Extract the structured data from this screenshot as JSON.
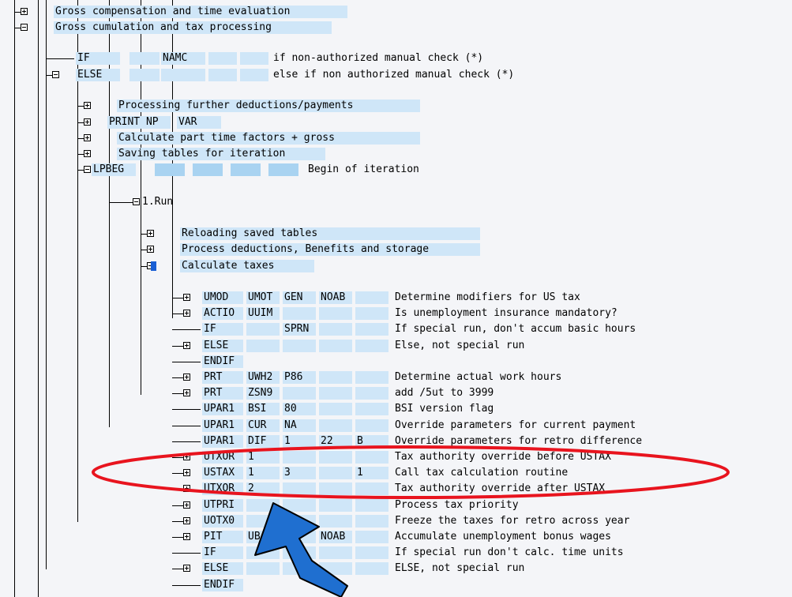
{
  "tree": {
    "nodes": [
      {
        "icon": "expand-plus-icon",
        "cols": [
          "Gross compensation and time evaluation"
        ]
      },
      {
        "icon": "collapse-minus-icon",
        "cols": [
          "Gross cumulation and tax processing"
        ]
      },
      {
        "icon": "",
        "cols": [
          "IF",
          "",
          "NAMC",
          "",
          "",
          "if non-authorized manual check (*)"
        ]
      },
      {
        "icon": "collapse-minus-icon",
        "cols": [
          "ELSE",
          "",
          "",
          "",
          "",
          "else if non authorized manual check (*)"
        ]
      },
      {
        "icon": "expand-plus-icon",
        "cols": [
          "Processing further deductions/payments"
        ]
      },
      {
        "icon": "expand-plus-icon",
        "cols": [
          "PRINT NP",
          "VAR"
        ]
      },
      {
        "icon": "expand-plus-icon",
        "cols": [
          "Calculate part time factors + gross"
        ]
      },
      {
        "icon": "expand-plus-icon",
        "cols": [
          "Saving tables for iteration"
        ]
      },
      {
        "icon": "collapse-minus-icon",
        "cols": [
          "LPBEG",
          "",
          "",
          "",
          "",
          "Begin of iteration"
        ]
      },
      {
        "icon": "collapse-minus-icon",
        "cols": [
          "1.Run"
        ]
      },
      {
        "icon": "expand-plus-icon",
        "cols": [
          "Reloading saved tables"
        ]
      },
      {
        "icon": "expand-plus-icon",
        "cols": [
          "Process deductions, Benefits and storage"
        ]
      },
      {
        "icon": "collapse-minus-icon",
        "cols": [
          "Calculate taxes"
        ]
      },
      {
        "icon": "expand-plus-icon",
        "cols": [
          "UMOD",
          "UMOT",
          "GEN",
          "NOAB",
          "",
          "Determine modifiers for US tax"
        ]
      },
      {
        "icon": "expand-plus-icon",
        "cols": [
          "ACTIO",
          "UUIM",
          "",
          "",
          "",
          "Is unemployment insurance mandatory?"
        ]
      },
      {
        "icon": "",
        "cols": [
          "IF",
          "",
          "SPRN",
          "",
          "",
          "If special run, don't accum basic hours"
        ]
      },
      {
        "icon": "expand-plus-icon",
        "cols": [
          "ELSE",
          "",
          "",
          "",
          "",
          "Else, not special run"
        ]
      },
      {
        "icon": "",
        "cols": [
          "ENDIF"
        ]
      },
      {
        "icon": "expand-plus-icon",
        "cols": [
          "PRT",
          "UWH2",
          "P86",
          "",
          "",
          "Determine actual work hours"
        ]
      },
      {
        "icon": "expand-plus-icon",
        "cols": [
          "PRT",
          "ZSN9",
          "",
          "",
          "",
          "add /5ut to 3999"
        ]
      },
      {
        "icon": "",
        "cols": [
          "UPAR1",
          "BSI",
          "80",
          "",
          "",
          "BSI version flag"
        ]
      },
      {
        "icon": "",
        "cols": [
          "UPAR1",
          "CUR",
          "NA",
          "",
          "",
          "Override parameters for current payment"
        ]
      },
      {
        "icon": "",
        "cols": [
          "UPAR1",
          "DIF",
          "1",
          "22",
          "B",
          "Override parameters for retro difference"
        ]
      },
      {
        "icon": "expand-plus-icon",
        "cols": [
          "UTXOR",
          "1",
          "",
          "",
          "",
          "Tax authority override before USTAX"
        ]
      },
      {
        "icon": "expand-plus-icon",
        "cols": [
          "USTAX",
          "1",
          "3",
          "",
          "1",
          "Call tax calculation routine"
        ]
      },
      {
        "icon": "expand-plus-icon",
        "cols": [
          "UTXOR",
          "2",
          "",
          "",
          "",
          "Tax authority override after USTAX"
        ]
      },
      {
        "icon": "expand-plus-icon",
        "cols": [
          "UTPRI",
          "",
          "",
          "",
          "",
          "Process tax priority"
        ]
      },
      {
        "icon": "expand-plus-icon",
        "cols": [
          "UOTX0",
          "",
          "",
          "",
          "",
          "Freeze the taxes for retro across year"
        ]
      },
      {
        "icon": "expand-plus-icon",
        "cols": [
          "PIT",
          "UB",
          "",
          "NOAB",
          "",
          "Accumulate unemployment bonus wages"
        ]
      },
      {
        "icon": "",
        "cols": [
          "IF",
          "",
          "",
          "",
          "",
          "If special run don't calc. time units"
        ]
      },
      {
        "icon": "expand-plus-icon",
        "cols": [
          "ELSE",
          "",
          "",
          "",
          "",
          "ELSE, not special run"
        ]
      },
      {
        "icon": "",
        "cols": [
          "ENDIF"
        ]
      }
    ]
  },
  "annotation": {
    "ellipse_color": "#e8141e",
    "arrow_color": "#1f6fd0",
    "arrow_outline": "#000000"
  },
  "colors": {
    "background": "#f4f5f8",
    "cell_light": "#cfe6f8",
    "cell_dark": "#a9d3f1",
    "selection": "#1a5fd4"
  }
}
